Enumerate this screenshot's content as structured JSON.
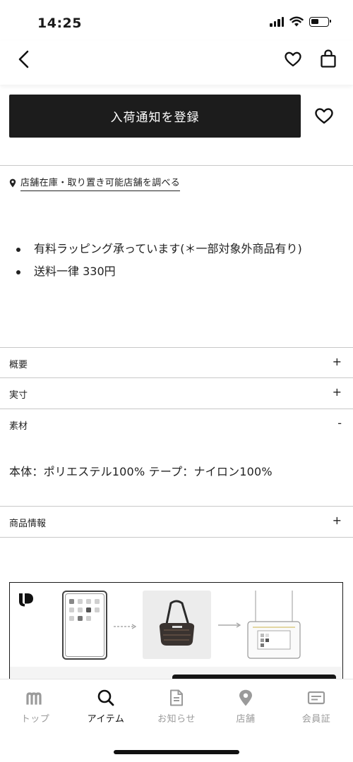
{
  "status_bar": {
    "time": "14:25"
  },
  "product": {
    "restock_button_label": "入荷通知を登録",
    "store_stock_link": "店舗在庫・取り置き可能店舗を調べる",
    "notes": [
      "有料ラッピング承っています(＊一部対象外商品有り)",
      "送料一律 330円"
    ]
  },
  "accordion": [
    {
      "label": "概要",
      "toggle": "+"
    },
    {
      "label": "実寸",
      "toggle": "+"
    },
    {
      "label": "素材",
      "toggle": "-"
    },
    {
      "label": "商品情報",
      "toggle": "+"
    }
  ],
  "material": {
    "text": "本体：ポリエステル100% テープ：ナイロン100%"
  },
  "tab_bar": {
    "tabs": [
      {
        "label": "トップ",
        "icon": "m-logo-icon",
        "active": false
      },
      {
        "label": "アイテム",
        "icon": "search-icon",
        "active": true
      },
      {
        "label": "お知らせ",
        "icon": "document-icon",
        "active": false
      },
      {
        "label": "店舗",
        "icon": "location-pin-icon",
        "active": false
      },
      {
        "label": "会員証",
        "icon": "membership-card-icon",
        "active": false
      }
    ]
  },
  "colors": {
    "primary_button": "#1c1c1c",
    "active_tab": "#111111",
    "inactive_tab": "#9a9a9a",
    "divider": "#c8c8c8"
  }
}
